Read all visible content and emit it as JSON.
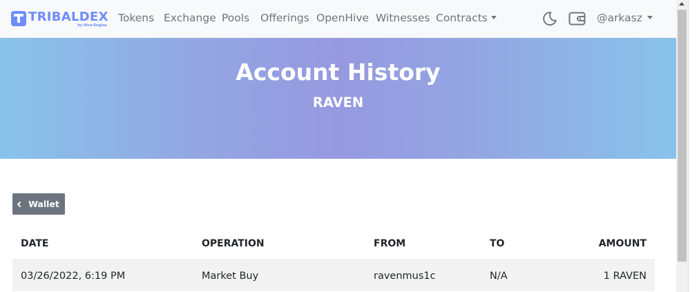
{
  "brand": {
    "name": "TRIBALDEX",
    "subtitle": "by Hive-Engine",
    "color": "#6f8cff"
  },
  "nav": {
    "tokens": "Tokens",
    "exchange": "Exchange",
    "pools": "Pools",
    "offerings": "Offerings",
    "openhive": "OpenHive",
    "witnesses": "Witnesses",
    "contracts": "Contracts",
    "account": "@arkasz"
  },
  "icons": {
    "theme_toggle": "moon-icon",
    "wallet": "wallet-icon",
    "back": "chevron-left-icon"
  },
  "hero": {
    "title": "Account History",
    "subtitle": "RAVEN"
  },
  "back_button": {
    "label": "Wallet"
  },
  "table": {
    "headers": {
      "date": "DATE",
      "operation": "OPERATION",
      "from": "FROM",
      "to": "TO",
      "amount": "AMOUNT"
    },
    "rows": [
      {
        "date": "03/26/2022, 6:19 PM",
        "operation": "Market Buy",
        "from": "ravenmus1c",
        "to": "N/A",
        "amount": "1 RAVEN"
      }
    ]
  },
  "colors": {
    "hero_edge": "#88c3ea",
    "hero_center": "#9699e0",
    "button": "#6c757d",
    "row_stripe": "#f2f2f2"
  }
}
